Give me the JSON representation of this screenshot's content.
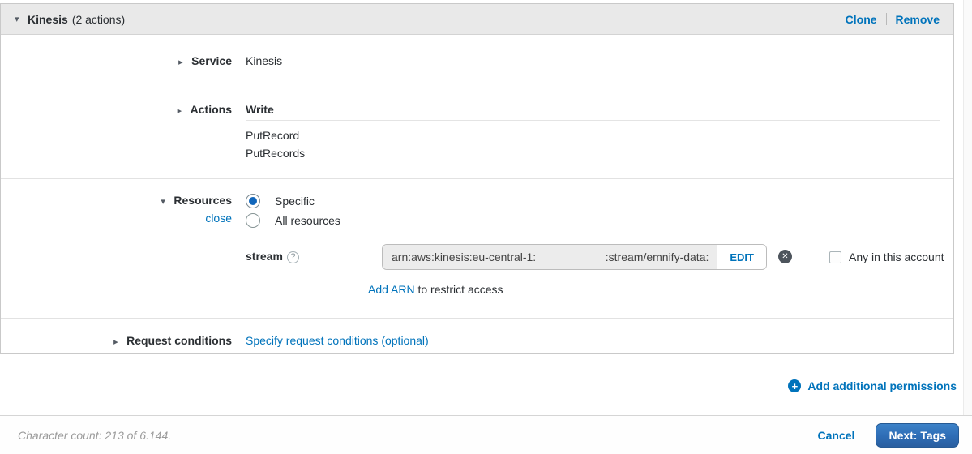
{
  "panel": {
    "header": {
      "title": "Kinesis",
      "subtitle": "(2 actions)",
      "clone_label": "Clone",
      "remove_label": "Remove"
    },
    "service": {
      "label": "Service",
      "value": "Kinesis"
    },
    "actions": {
      "label": "Actions",
      "group": "Write",
      "items": [
        "PutRecord",
        "PutRecords"
      ]
    },
    "resources": {
      "label": "Resources",
      "close_label": "close",
      "options": [
        {
          "label": "Specific",
          "selected": true
        },
        {
          "label": "All resources",
          "selected": false
        }
      ],
      "stream": {
        "label": "stream",
        "arn_prefix": "arn:aws:kinesis:eu-central-1:",
        "arn_suffix": ":stream/emnify-data:",
        "edit_label": "EDIT",
        "any_in_account_label": "Any in this account",
        "any_in_account_checked": false
      },
      "add_arn": {
        "link": "Add ARN",
        "rest": "to restrict access"
      }
    },
    "request_conditions": {
      "label": "Request conditions",
      "link": "Specify request conditions (optional)"
    }
  },
  "add_permissions_label": "Add additional permissions",
  "footer": {
    "char_count": "Character count: 213 of 6.144.",
    "cancel_label": "Cancel",
    "next_label": "Next: Tags"
  },
  "icons": {
    "caret_down": "▾",
    "caret_right": "▸",
    "help": "?",
    "close_x": "✕",
    "plus": "+"
  },
  "colors": {
    "link_blue": "#0073bb",
    "primary_button_blue": "#2d6cb5",
    "header_gray": "#e9e9e9",
    "radio_selected_blue": "#1166bb"
  }
}
